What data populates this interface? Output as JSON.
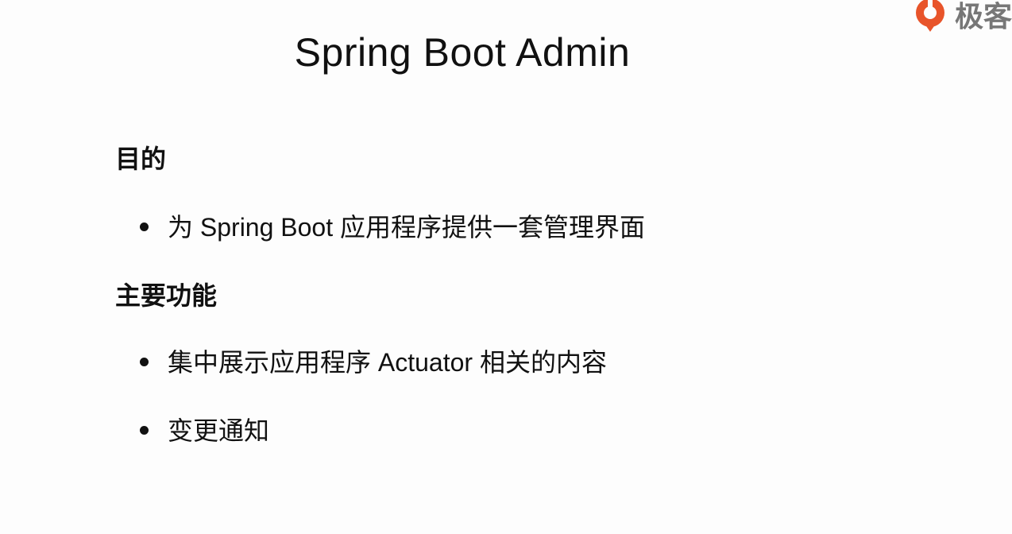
{
  "slide": {
    "title": "Spring Boot Admin",
    "sections": [
      {
        "heading": "目的",
        "bullets": [
          "为 Spring Boot 应用程序提供一套管理界面"
        ]
      },
      {
        "heading": "主要功能",
        "bullets": [
          "集中展示应用程序 Actuator 相关的内容",
          "变更通知"
        ]
      }
    ]
  },
  "logo": {
    "text": "极客",
    "icon": "geektime-logo-icon",
    "color": "#e8542a"
  },
  "colors": {
    "background": "#fdfdfd",
    "text": "#111111"
  }
}
